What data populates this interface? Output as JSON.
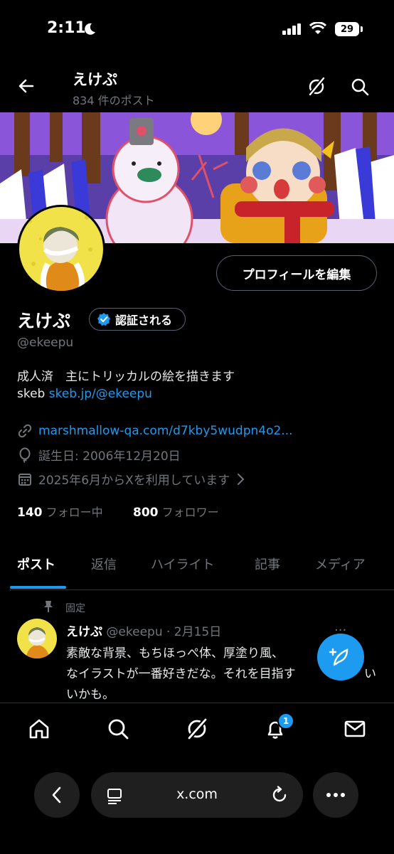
{
  "status_bar": {
    "time": "2:11",
    "battery": "29"
  },
  "header": {
    "name": "えけぷ",
    "post_count": "834 件のポスト"
  },
  "profile": {
    "edit_button": "プロフィールを編集",
    "name": "えけぷ",
    "verify_label": "認証される",
    "handle": "@ekeepu",
    "bio_line1": "成人済　主にトリッカルの絵を描きます",
    "bio_line2_prefix": "skeb ",
    "bio_link": "skeb.jp/@ekeepu",
    "website": "marshmallow-qa.com/d7kby5wudpn4o2...",
    "birthday": "誕生日: 2006年12月20日",
    "joined": "2025年6月からXを利用しています",
    "following_count": "140",
    "following_label": "フォロー中",
    "followers_count": "800",
    "followers_label": "フォロワー"
  },
  "tabs": [
    {
      "label": "ポスト"
    },
    {
      "label": "返信"
    },
    {
      "label": "ハイライト"
    },
    {
      "label": "記事"
    },
    {
      "label": "メディア"
    }
  ],
  "post": {
    "pinned_label": "固定",
    "author": "えけぷ",
    "meta": "@ekeepu · 2月15日",
    "line1": "素敵な背景、もちほっぺ体、厚塗り風、",
    "line2": "なイラストが一番好きだな。それを目指す",
    "line2_tail": "い",
    "line3": "いかも。"
  },
  "bottom_nav": {
    "notification_badge": "1"
  },
  "browser": {
    "url": "x.com"
  },
  "colors": {
    "accent": "#1d9bf0",
    "background": "#000000",
    "secondary_text": "#71767b"
  },
  "icons": [
    "moon-icon",
    "signal-icon",
    "wifi-icon",
    "battery-icon",
    "back-arrow-icon",
    "grok-icon",
    "search-icon",
    "verified-badge-icon",
    "link-icon",
    "balloon-icon",
    "calendar-icon",
    "chevron-right-icon",
    "pin-icon",
    "compose-icon",
    "home-icon",
    "bell-icon",
    "mail-icon",
    "more-icon",
    "tabs-icon",
    "reload-icon"
  ]
}
